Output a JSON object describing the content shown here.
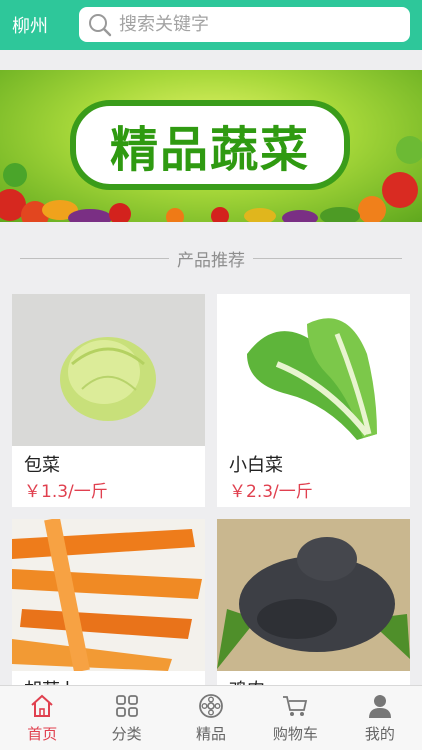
{
  "header": {
    "city": "柳州",
    "search_placeholder": "搜索关键字"
  },
  "banner": {
    "title": "精品蔬菜"
  },
  "section": {
    "title": "产品推荐"
  },
  "products": [
    {
      "name": "包菜",
      "price": "￥1.3/一斤"
    },
    {
      "name": "小白菜",
      "price": "￥2.3/一斤"
    },
    {
      "name": "胡萝卜",
      "price": ""
    },
    {
      "name": "鸡肉",
      "price": ""
    }
  ],
  "tabs": [
    {
      "label": "首页",
      "icon": "home-icon",
      "active": true
    },
    {
      "label": "分类",
      "icon": "grid-icon",
      "active": false
    },
    {
      "label": "精品",
      "icon": "premium-icon",
      "active": false
    },
    {
      "label": "购物车",
      "icon": "cart-icon",
      "active": false
    },
    {
      "label": "我的",
      "icon": "user-icon",
      "active": false
    }
  ],
  "colors": {
    "header_bg": "#2ec79a",
    "price": "#e0404f",
    "active_tab": "#e0404f"
  }
}
